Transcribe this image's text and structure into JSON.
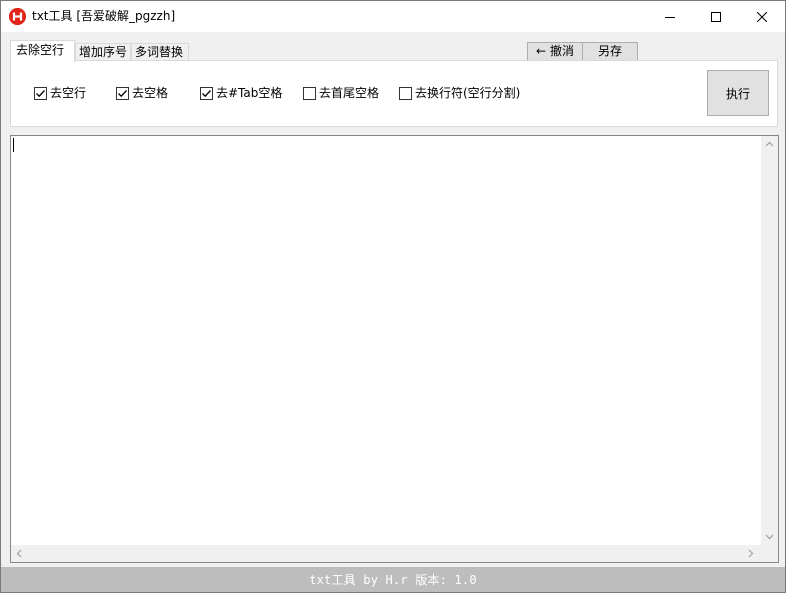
{
  "window": {
    "title": "txt工具 [吾爱破解_pgzzh]",
    "icon": "app-logo-icon"
  },
  "tabs": [
    {
      "label": "去除空行",
      "active": true
    },
    {
      "label": "增加序号",
      "active": false
    },
    {
      "label": "多词替换",
      "active": false
    }
  ],
  "toolbar": {
    "undo_arrow": "←",
    "undo_label": "撤消",
    "saveas_label": "另存"
  },
  "options": [
    {
      "label": "去空行",
      "checked": true
    },
    {
      "label": "去空格",
      "checked": true
    },
    {
      "label": "去#Tab空格",
      "checked": true
    },
    {
      "label": "去首尾空格",
      "checked": false
    },
    {
      "label": "去换行符(空行分割)",
      "checked": false
    }
  ],
  "execute_label": "执行",
  "editor": {
    "value": ""
  },
  "status": {
    "text": "txt工具 by H.r  版本: 1.0"
  },
  "colors": {
    "icon_red": "#e1251b",
    "statusbar_bg": "#bdbdbd",
    "panel_bg": "#ffffff",
    "window_bg": "#f0f0f0"
  }
}
